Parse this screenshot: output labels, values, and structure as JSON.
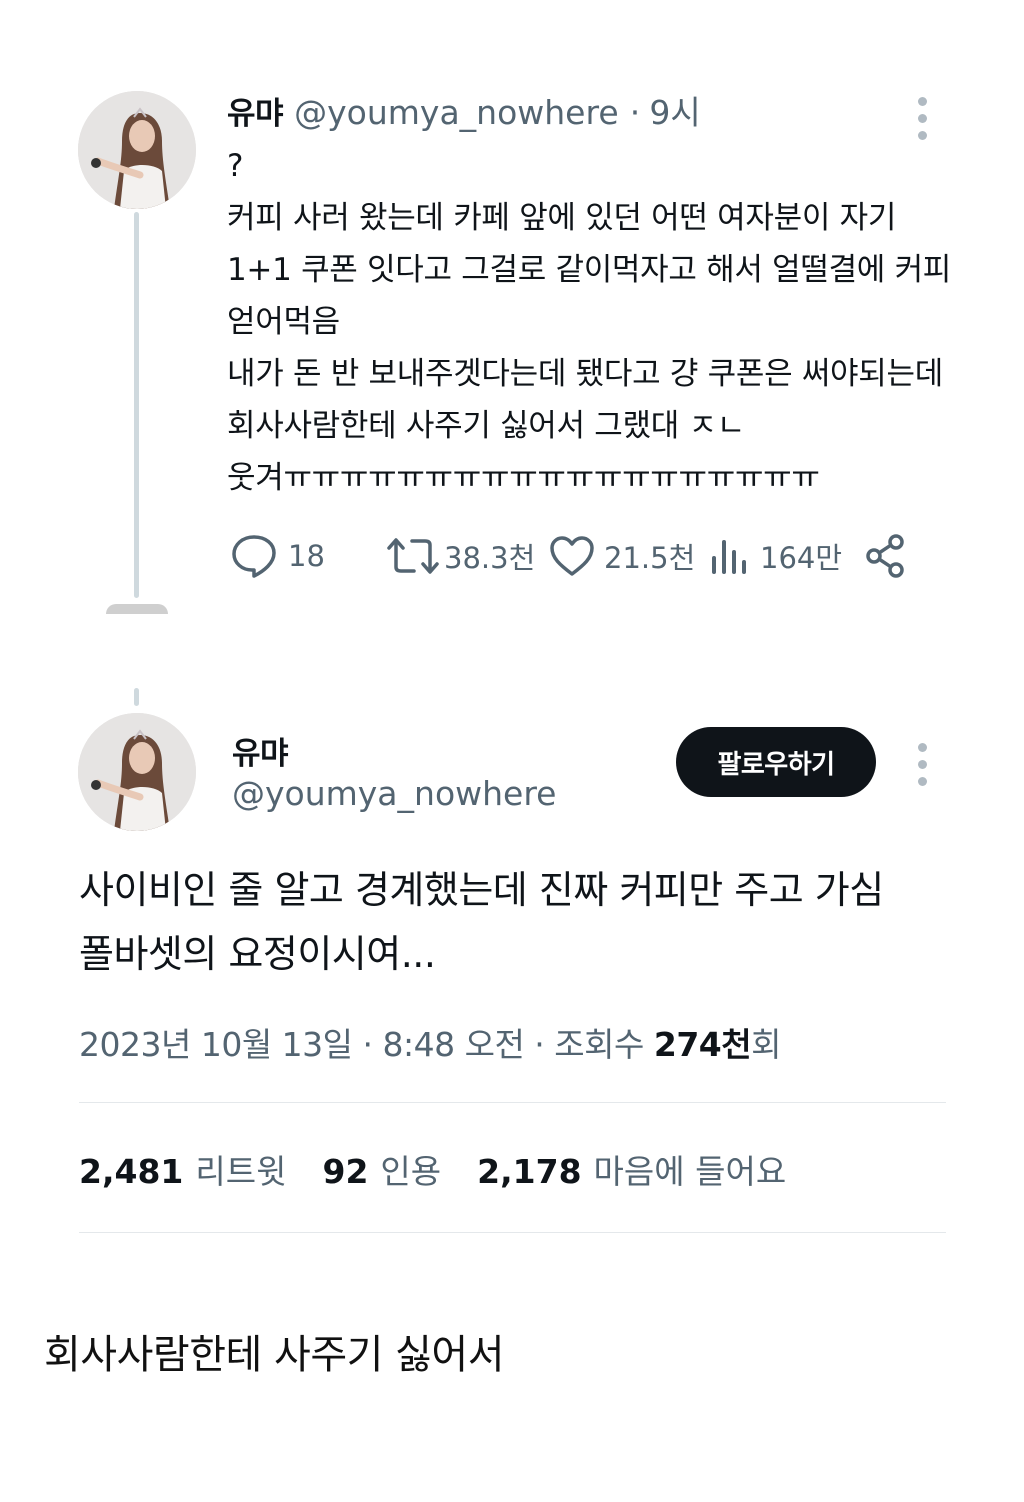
{
  "tweet1": {
    "display_name": "유먀",
    "handle": "@youmya_nowhere",
    "separator": "·",
    "time": "9시",
    "lines": [
      "?",
      "커피 사러 왔는데 카페 앞에 있던 어떤 여자분이 자기",
      "1+1 쿠폰 잇다고 그걸로 같이먹자고 해서 얼떨결에 커피",
      "얻어먹음",
      "내가 돈 반 보내주겟다는데 됐다고 걍 쿠폰은 써야되는데",
      "회사사람한테 사주기 싫어서 그랬대 ㅈㄴ",
      "웃겨ㅠㅠㅠㅠㅠㅠㅠㅠㅠㅠㅠㅠㅠㅠㅠㅠㅠㅠㅠ"
    ],
    "actions": {
      "replies": "18",
      "retweets": "38.3천",
      "likes": "21.5천",
      "views": "164만"
    },
    "icons": [
      "reply-icon",
      "retweet-icon",
      "like-icon",
      "views-icon",
      "share-icon",
      "more-icon"
    ]
  },
  "tweet2": {
    "display_name": "유먀",
    "handle": "@youmya_nowhere",
    "follow_label": "팔로우하기",
    "lines": [
      "사이비인 줄 알고 경계했는데 진짜 커피만 주고 가심",
      "폴바셋의 요정이시여..."
    ],
    "timestamp_prefix": "2023년 10월 13일 · 8:48 오전 · 조회수 ",
    "views_bold": "274천",
    "views_suffix": "회",
    "stats": {
      "retweets_num": "2,481",
      "retweets_label": "리트윗",
      "quotes_num": "92",
      "quotes_label": "인용",
      "likes_num": "2,178",
      "likes_label": "마음에 들어요"
    }
  },
  "caption": "회사사람한테 사주기 싫어서",
  "colors": {
    "text": "#0f1419",
    "secondary": "#536471",
    "button_bg": "#0f1419",
    "thread_line": "#cfd9de"
  }
}
